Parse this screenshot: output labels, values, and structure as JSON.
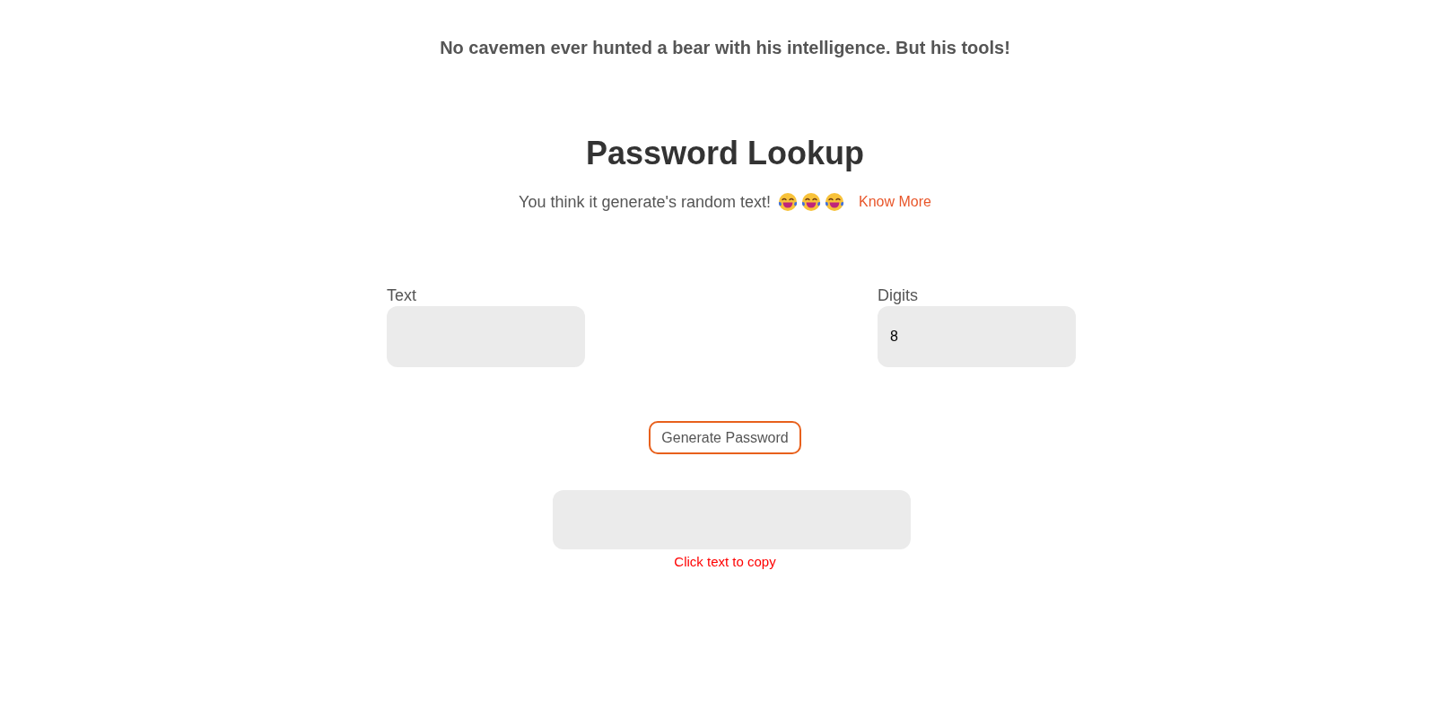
{
  "header": {
    "quote": "No cavemen ever hunted a bear with his intelligence. But his tools!"
  },
  "title": "Password Lookup",
  "subtitle": {
    "text": "You think it generate's random text!",
    "link": "Know More"
  },
  "fields": [
    {
      "label": "Text"
    },
    {
      "label": "Digits",
      "value": "8"
    }
  ],
  "generate_button": {
    "label": "Generate Password"
  },
  "output": {
    "hint": "Click text to copy"
  }
}
